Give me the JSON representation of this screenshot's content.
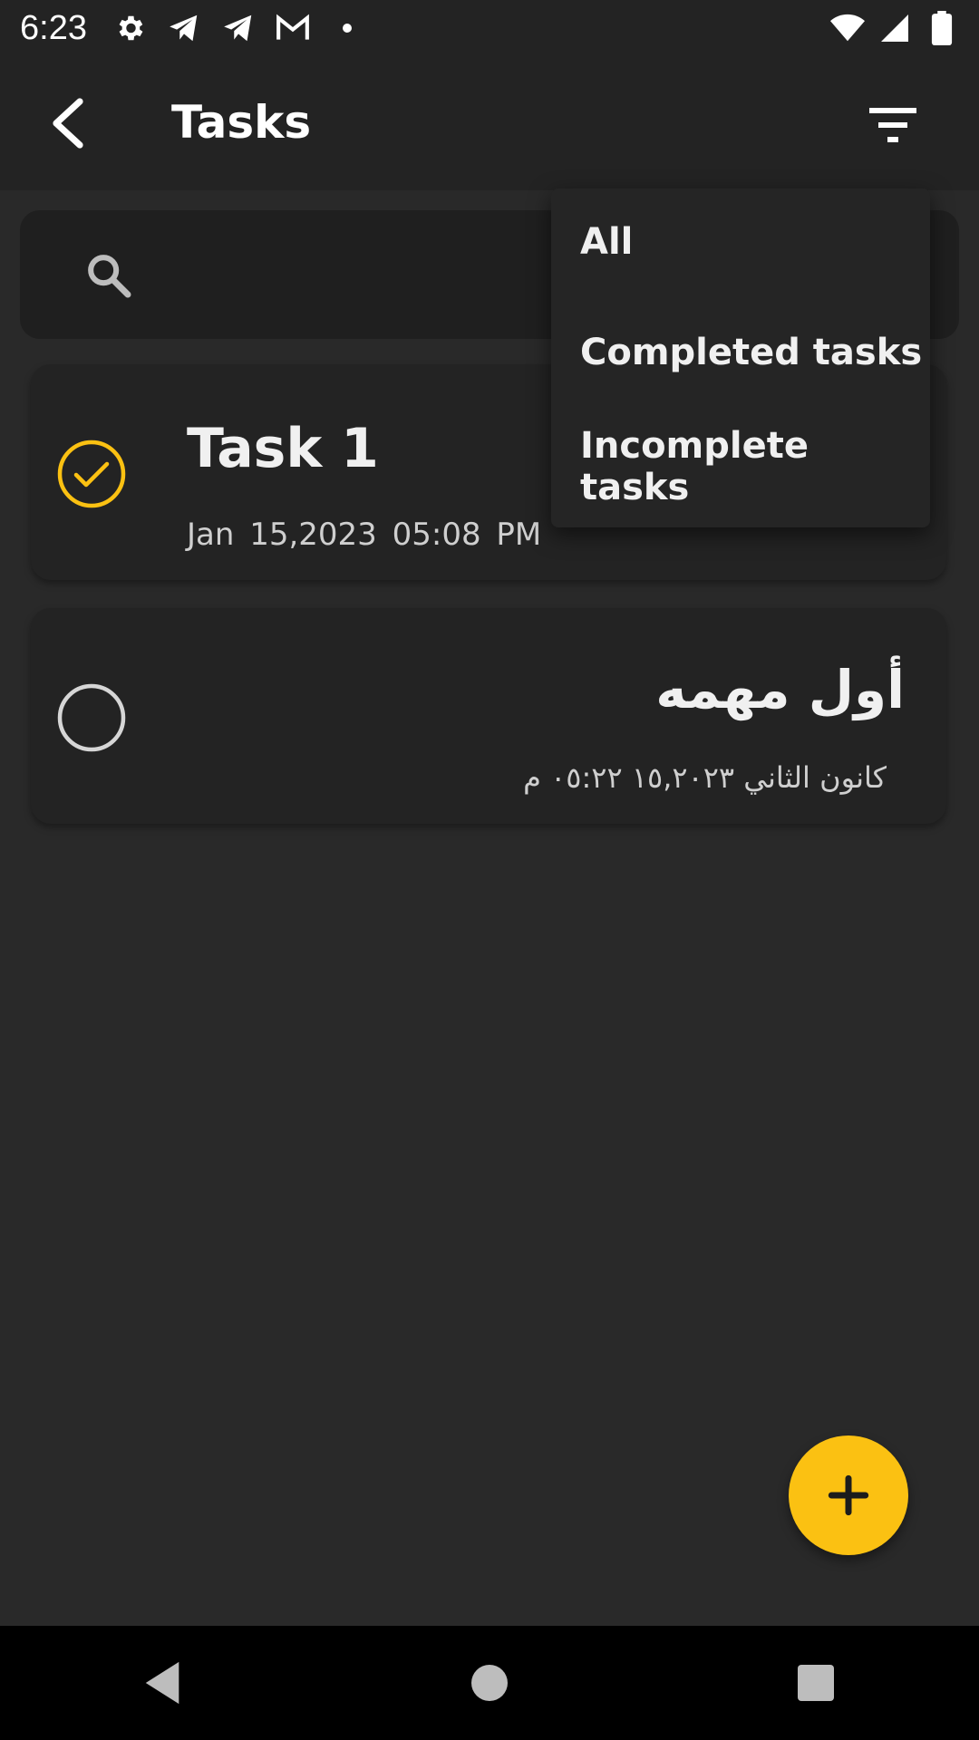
{
  "status_bar": {
    "time": "6:23",
    "left_icons": [
      "settings-icon",
      "telegram-icon",
      "telegram-icon",
      "gmail-icon",
      "dot-icon"
    ],
    "right_icons": [
      "wifi-icon",
      "signal-icon",
      "battery-icon"
    ]
  },
  "app_bar": {
    "title": "Tasks",
    "back_icon": "back-arrow-icon",
    "filter_icon": "filter-icon"
  },
  "search": {
    "icon": "search-icon",
    "placeholder": ""
  },
  "tasks": [
    {
      "title": "Task 1",
      "date": "Jan 15,2023  05:08 PM",
      "completed": true
    },
    {
      "title": "أول مهمه",
      "date": "كانون الثاني ١٥,٢٠٢٣  ٠٥:٢٢ م",
      "completed": false
    }
  ],
  "filter_menu": {
    "items": [
      "All",
      "Completed tasks",
      "Incomplete tasks"
    ]
  },
  "fab": {
    "icon": "plus-icon"
  },
  "nav_bar": {
    "buttons": [
      "back-icon",
      "home-icon",
      "recents-icon"
    ]
  },
  "colors": {
    "accent": "#fbc112",
    "background": "#292929",
    "surface": "#232323",
    "menu": "#252525"
  }
}
